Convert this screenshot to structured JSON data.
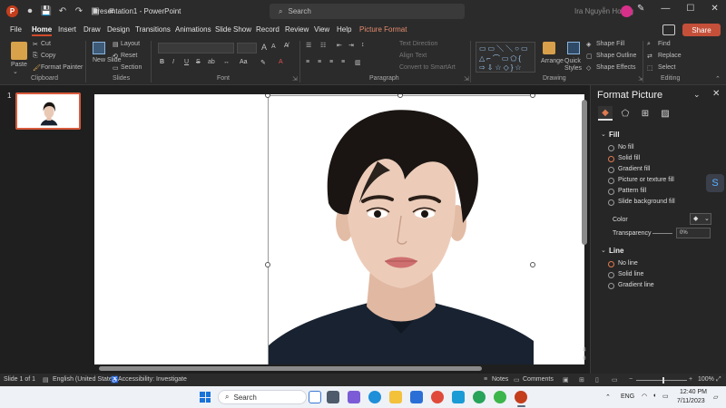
{
  "titlebar": {
    "app_logo": "P",
    "doc_title": "Presentation1  -  PowerPoint",
    "search_placeholder": "Search",
    "user_name": "Ira Nguyễn Hoàng",
    "controls": [
      "—",
      "☐",
      "✕"
    ]
  },
  "menu": {
    "tabs": [
      "File",
      "Home",
      "Insert",
      "Draw",
      "Design",
      "Transitions",
      "Animations",
      "Slide Show",
      "Record",
      "Review",
      "View",
      "Help",
      "Picture Format"
    ],
    "active": "Home",
    "share_label": "Share"
  },
  "ribbon": {
    "clipboard": {
      "paste": "Paste",
      "cut": "Cut",
      "copy": "Copy",
      "format_painter": "Format Painter",
      "label": "Clipboard"
    },
    "slides": {
      "new_slide": "New Slide",
      "layout": "Layout",
      "reset": "Reset",
      "section": "Section",
      "label": "Slides"
    },
    "font": {
      "label": "Font",
      "grow": "A",
      "shrink": "A",
      "bold": "B",
      "italic": "I",
      "underline": "U",
      "strike": "S",
      "shadow": "ab"
    },
    "paragraph": {
      "text_direction": "Text Direction",
      "align_text": "Align Text",
      "convert_smartart": "Convert to SmartArt",
      "label": "Paragraph"
    },
    "drawing": {
      "arrange": "Arrange",
      "quick_styles": "Quick Styles",
      "shape_fill": "Shape Fill",
      "shape_outline": "Shape Outline",
      "shape_effects": "Shape Effects",
      "label": "Drawing"
    },
    "editing": {
      "find": "Find",
      "replace": "Replace",
      "select": "Select",
      "label": "Editing"
    }
  },
  "thumbnails": {
    "slide_number": "1"
  },
  "format_pane": {
    "title": "Format Picture",
    "fill_heading": "Fill",
    "fill_options": [
      "No fill",
      "Solid fill",
      "Gradient fill",
      "Picture or texture fill",
      "Pattern fill",
      "Slide background fill"
    ],
    "fill_selected": "Solid fill",
    "color_label": "Color",
    "transparency_label": "Transparency",
    "transparency_value": "0%",
    "line_heading": "Line",
    "line_options": [
      "No line",
      "Solid line",
      "Gradient line"
    ],
    "line_selected": "No line"
  },
  "statusbar": {
    "slide_info": "Slide 1 of 1",
    "language": "English (United States)",
    "accessibility": "Accessibility: Investigate",
    "notes": "Notes",
    "comments": "Comments",
    "zoom": "100%"
  },
  "taskbar": {
    "search_placeholder": "Search",
    "lang": "ENG",
    "time": "12:40 PM",
    "date": "7/11/2023"
  },
  "colors": {
    "accent": "#d2492a",
    "share": "#c4503a",
    "radio_on": "#e07a4f",
    "shirt": "#182230",
    "hair": "#1a1512",
    "skin": "#e9c8b4"
  }
}
